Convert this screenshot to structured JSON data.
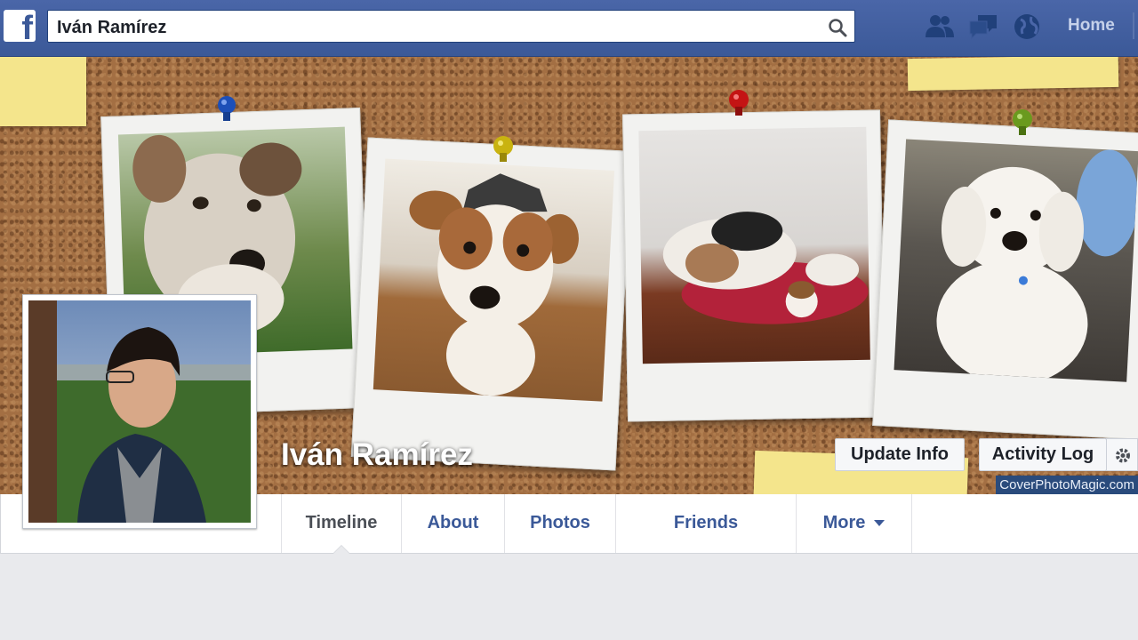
{
  "header": {
    "logo_letter": "f",
    "search_value": "Iván Ramírez",
    "nav_icons": [
      "friend-requests-icon",
      "messages-icon",
      "notifications-globe-icon"
    ],
    "home_label": "Home"
  },
  "cover": {
    "watermark": "CoverPhotoMagic.com"
  },
  "profile": {
    "name": "Iván Ramírez",
    "update_info_label": "Update Info",
    "activity_log_label": "Activity Log"
  },
  "tabs": [
    {
      "label": "Timeline",
      "active": true
    },
    {
      "label": "About",
      "active": false
    },
    {
      "label": "Photos",
      "active": false
    },
    {
      "label": "Friends",
      "active": false
    },
    {
      "label": "More",
      "active": false
    }
  ],
  "colors": {
    "brand_blue": "#3b5998",
    "cork": "#a36f43",
    "sticky_note": "#f4e58c"
  }
}
